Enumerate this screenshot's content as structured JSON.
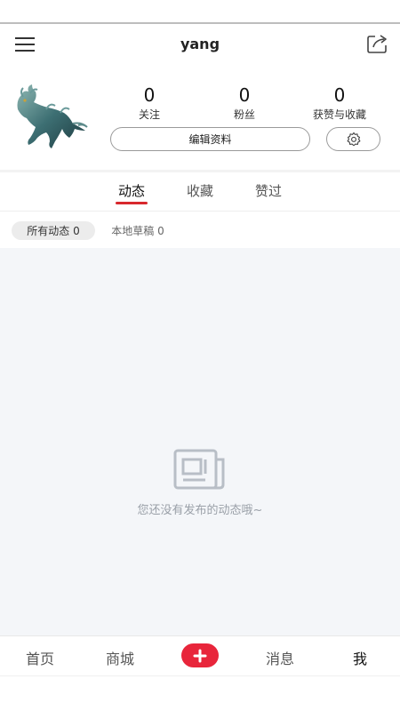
{
  "header": {
    "title": "yang",
    "menu_icon": "menu-icon",
    "share_icon": "share-icon"
  },
  "profile": {
    "avatar_icon": "qilin-avatar",
    "stats": [
      {
        "value": "0",
        "label": "关注"
      },
      {
        "value": "0",
        "label": "粉丝"
      },
      {
        "value": "0",
        "label": "获赞与收藏"
      }
    ],
    "edit_button_label": "编辑资料",
    "settings_icon": "gear-icon"
  },
  "tabs": {
    "items": [
      {
        "label": "动态",
        "active": true
      },
      {
        "label": "收藏",
        "active": false
      },
      {
        "label": "赞过",
        "active": false
      }
    ],
    "accent_color": "#d8282d"
  },
  "filters": {
    "items": [
      {
        "label": "所有动态 0",
        "active": true
      },
      {
        "label": "本地草稿 0",
        "active": false
      }
    ]
  },
  "content": {
    "empty_icon": "newspaper-icon",
    "empty_text": "您还没有发布的动态哦~"
  },
  "bottom_nav": {
    "items": [
      {
        "label": "首页",
        "active": false
      },
      {
        "label": "商城",
        "active": false
      },
      {
        "label": "消息",
        "active": false
      },
      {
        "label": "我",
        "active": true
      }
    ],
    "add_button_symbol": "+",
    "add_button_color": "#e8253b"
  }
}
